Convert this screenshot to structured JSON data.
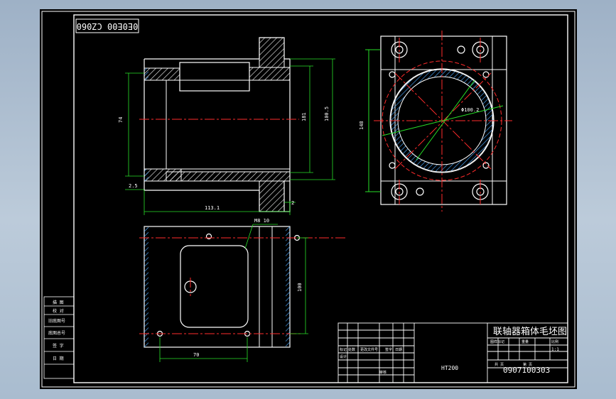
{
  "drawing": {
    "drawing_code_rotated": "0E0E00 CZ060",
    "title": "联轴器箱体毛坯图",
    "material": "HT200",
    "drawing_number": "0907100303",
    "scale": "1:1"
  },
  "dims": {
    "total_length": "113.1",
    "left_step": "2.5",
    "right_step": "2",
    "inner_dia": "74",
    "outer_dia": "100.5",
    "right_dia": "181",
    "flange_dia": "148",
    "bolt_circle": "Φ100.2",
    "slot": "M8 10",
    "hole_spacing": "70",
    "side_height": "100"
  },
  "titleblock": {
    "left_rows": [
      "描 图",
      "校 对",
      "旧底图号",
      "底图总号",
      "签 字",
      "日 期"
    ],
    "row_a": [
      "标记",
      "处数",
      "更改文件号",
      "签字",
      "日期"
    ],
    "row_b": [
      "设计"
    ],
    "row_c": [
      "审核"
    ],
    "right_header": [
      "图样标记",
      "重量",
      "比例"
    ],
    "right_labels": [
      "共 页",
      "第 页"
    ]
  }
}
